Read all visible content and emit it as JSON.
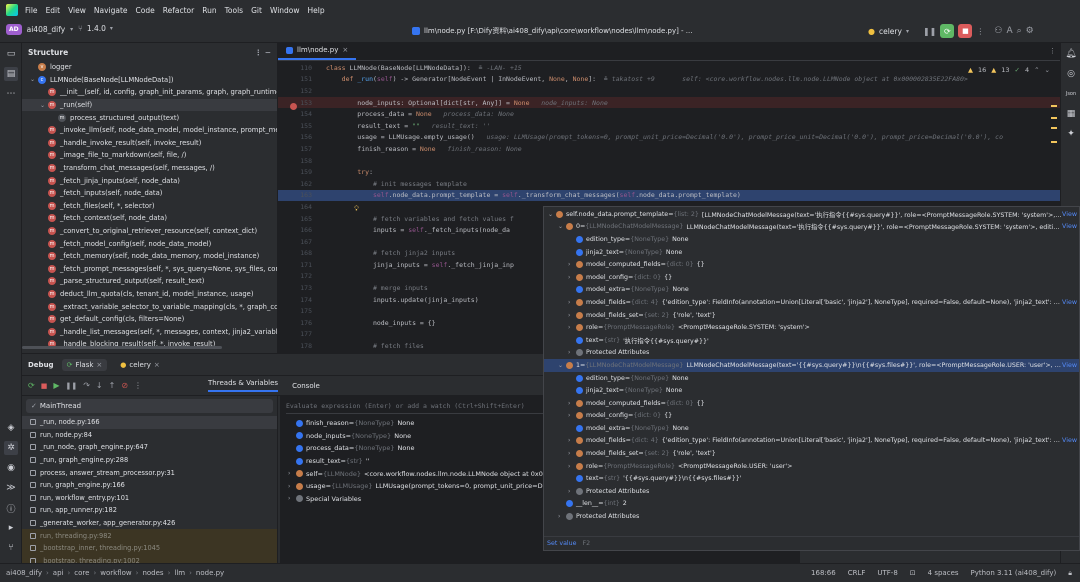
{
  "menu": [
    "File",
    "Edit",
    "View",
    "Navigate",
    "Code",
    "Refactor",
    "Run",
    "Tools",
    "Git",
    "Window",
    "Help"
  ],
  "project": {
    "badge": "AD",
    "name": "ai408_dify",
    "branch": "1.4.0"
  },
  "window_title": "llm\\node.py [F:\\Dify资料\\ai408_dify\\api\\core\\workflow\\nodes\\llm\\node.py] - ...",
  "run_config": "celery",
  "structure": {
    "title": "Structure",
    "items": [
      {
        "label": "logger",
        "indent": 0,
        "kind": "var",
        "arrow": ""
      },
      {
        "label": "LLMNode(BaseNode[LLMNodeData])",
        "indent": 0,
        "kind": "class",
        "arrow": "v"
      },
      {
        "label": "__init__(self, id, config, graph_init_params, graph, graph_runtime_state, pr",
        "indent": 1,
        "kind": "m",
        "arrow": ""
      },
      {
        "label": "_run(self)",
        "indent": 1,
        "kind": "m",
        "arrow": "v"
      },
      {
        "label": "process_structured_output(text)",
        "indent": 2,
        "kind": "f",
        "arrow": ""
      },
      {
        "label": "_invoke_llm(self, node_data_model, model_instance, prompt_messages, s",
        "indent": 1,
        "kind": "m",
        "arrow": ""
      },
      {
        "label": "_handle_invoke_result(self, invoke_result)",
        "indent": 1,
        "kind": "m",
        "arrow": ""
      },
      {
        "label": "_image_file_to_markdown(self, file, /)",
        "indent": 1,
        "kind": "m",
        "arrow": ""
      },
      {
        "label": "_transform_chat_messages(self, messages, /)",
        "indent": 1,
        "kind": "m",
        "arrow": ""
      },
      {
        "label": "_fetch_jinja_inputs(self, node_data)",
        "indent": 1,
        "kind": "m",
        "arrow": ""
      },
      {
        "label": "_fetch_inputs(self, node_data)",
        "indent": 1,
        "kind": "m",
        "arrow": ""
      },
      {
        "label": "_fetch_files(self, *, selector)",
        "indent": 1,
        "kind": "m",
        "arrow": ""
      },
      {
        "label": "_fetch_context(self, node_data)",
        "indent": 1,
        "kind": "m",
        "arrow": ""
      },
      {
        "label": "_convert_to_original_retriever_resource(self, context_dict)",
        "indent": 1,
        "kind": "m",
        "arrow": ""
      },
      {
        "label": "_fetch_model_config(self, node_data_model)",
        "indent": 1,
        "kind": "m",
        "arrow": ""
      },
      {
        "label": "_fetch_memory(self, node_data_memory, model_instance)",
        "indent": 1,
        "kind": "m",
        "arrow": ""
      },
      {
        "label": "_fetch_prompt_messages(self, *, sys_query=None, sys_files, context=None",
        "indent": 1,
        "kind": "m",
        "arrow": ""
      },
      {
        "label": "_parse_structured_output(self, result_text)",
        "indent": 1,
        "kind": "m",
        "arrow": ""
      },
      {
        "label": "deduct_llm_quota(cls, tenant_id, model_instance, usage)",
        "indent": 1,
        "kind": "m",
        "arrow": ""
      },
      {
        "label": "_extract_variable_selector_to_variable_mapping(cls, *, graph_config, node",
        "indent": 1,
        "kind": "m",
        "arrow": ""
      },
      {
        "label": "get_default_config(cls, filters=None)",
        "indent": 1,
        "kind": "m",
        "arrow": ""
      },
      {
        "label": "_handle_list_messages(self, *, messages, context, jinja2_variables, variable",
        "indent": 1,
        "kind": "m",
        "arrow": ""
      },
      {
        "label": "_handle_blocking_result(self, *, invoke_result)",
        "indent": 1,
        "kind": "m",
        "arrow": ""
      }
    ]
  },
  "editor": {
    "tab": "llm\\node.py",
    "inspections": {
      "warnings": "16",
      "weak": "13",
      "typos": "4"
    },
    "lines": [
      {
        "n": "110",
        "html": "<span class=\"kw\">class</span> LLMNode(BaseNode[LLMNodeData]):  <span class=\"hint\">≗ -LAN- +15</span>",
        "cls": ""
      },
      {
        "n": "151",
        "html": "    <span class=\"kw\">def</span> <span class=\"fn\">_run</span>(<span class=\"self\">self</span>) -&gt; Generator[NodeEvent | InNodeEvent, <span class=\"kw\">None</span>, <span class=\"kw\">None</span>]:  <span class=\"hint\">≗ takatost +9       self: &lt;core.workflow.nodes.llm.node.LLMNode object at 0x000002835E22FA80&gt;</span>",
        "cls": ""
      },
      {
        "n": "152",
        "html": "",
        "cls": ""
      },
      {
        "n": "153",
        "html": "        node_inputs: Optional[dict[str, Any]] = <span class=\"kw\">None</span>   <span class=\"hint\">node_inputs: None</span>",
        "cls": "bp"
      },
      {
        "n": "154",
        "html": "        process_data = <span class=\"kw\">None</span>   <span class=\"hint\">process_data: None</span>",
        "cls": ""
      },
      {
        "n": "155",
        "html": "        result_text = <span class=\"str\">\"\"</span>   <span class=\"hint\">result_text: ''</span>",
        "cls": ""
      },
      {
        "n": "156",
        "html": "        usage = LLMUsage.empty_usage()   <span class=\"hint\">usage: LLMUsage(prompt_tokens=0, prompt_unit_price=Decimal('0.0'), prompt_price_unit=Decimal('0.0'), prompt_price=Decimal('0.0'), co</span>",
        "cls": ""
      },
      {
        "n": "157",
        "html": "        finish_reason = <span class=\"kw\">None</span>   <span class=\"hint\">finish_reason: None</span>",
        "cls": ""
      },
      {
        "n": "158",
        "html": "",
        "cls": ""
      },
      {
        "n": "159",
        "html": "        <span class=\"kw\">try</span>:",
        "cls": ""
      },
      {
        "n": "162",
        "html": "            <span class=\"cm\"># init messages template</span>",
        "cls": ""
      },
      {
        "n": "163",
        "html": "            <span class=\"self\">self</span>.node_data.prompt_template = <span class=\"self\">self</span>._transform_chat_messages(<span class=\"self\">self</span>.node_data.prompt_template)",
        "cls": "exec"
      },
      {
        "n": "164",
        "html": "",
        "cls": ""
      },
      {
        "n": "165",
        "html": "            <span class=\"cm\"># fetch variables and fetch values f</span>",
        "cls": ""
      },
      {
        "n": "166",
        "html": "            inputs = <span class=\"self\">self</span>._fetch_inputs(node_da",
        "cls": ""
      },
      {
        "n": "167",
        "html": "",
        "cls": ""
      },
      {
        "n": "168",
        "html": "            <span class=\"cm\"># fetch jinja2 inputs</span>",
        "cls": ""
      },
      {
        "n": "171",
        "html": "            jinja_inputs = <span class=\"self\">self</span>._fetch_jinja_inp",
        "cls": ""
      },
      {
        "n": "172",
        "html": "",
        "cls": ""
      },
      {
        "n": "173",
        "html": "            <span class=\"cm\"># merge inputs</span>",
        "cls": ""
      },
      {
        "n": "174",
        "html": "            inputs.update(jinja_inputs)",
        "cls": ""
      },
      {
        "n": "175",
        "html": "",
        "cls": ""
      },
      {
        "n": "176",
        "html": "            node_inputs = {}",
        "cls": ""
      },
      {
        "n": "177",
        "html": "",
        "cls": ""
      },
      {
        "n": "178",
        "html": "            <span class=\"cm\"># fetch files</span>",
        "cls": ""
      }
    ]
  },
  "debug": {
    "label": "Debug",
    "configs": [
      "Flask",
      "celery"
    ],
    "tabs": [
      "Threads & Variables",
      "Console"
    ],
    "thread": "MainThread",
    "eval_placeholder": "Evaluate expression (Enter) or add a watch (Ctrl+Shift+Enter)",
    "frames": [
      {
        "label": "_run, node.py:166",
        "dim": false,
        "sel": true
      },
      {
        "label": "run, node.py:84",
        "dim": false,
        "sel": false
      },
      {
        "label": "_run_node, graph_engine.py:647",
        "dim": false,
        "sel": false
      },
      {
        "label": "_run, graph_engine.py:288",
        "dim": false,
        "sel": false
      },
      {
        "label": "process, answer_stream_processor.py:31",
        "dim": false,
        "sel": false
      },
      {
        "label": "run, graph_engine.py:166",
        "dim": false,
        "sel": false
      },
      {
        "label": "run, workflow_entry.py:101",
        "dim": false,
        "sel": false
      },
      {
        "label": "run, app_runner.py:182",
        "dim": false,
        "sel": false
      },
      {
        "label": "_generate_worker, app_generator.py:426",
        "dim": false,
        "sel": false
      },
      {
        "label": "run, threading.py:982",
        "dim": true,
        "sel": false
      },
      {
        "label": "_bootstrap_inner, threading.py:1045",
        "dim": true,
        "sel": false
      },
      {
        "label": "_bootstrap, threading.py:1002",
        "dim": true,
        "sel": false
      }
    ],
    "variables": [
      {
        "arrow": "",
        "name": "finish_reason",
        "type": "{NoneType}",
        "value": "None",
        "icon": "b"
      },
      {
        "arrow": "",
        "name": "node_inputs",
        "type": "{NoneType}",
        "value": "None",
        "icon": "b"
      },
      {
        "arrow": "",
        "name": "process_data",
        "type": "{NoneType}",
        "value": "None",
        "icon": "b"
      },
      {
        "arrow": "",
        "name": "result_text",
        "type": "{str}",
        "value": "''",
        "icon": "b"
      },
      {
        "arrow": ">",
        "name": "self",
        "type": "{LLMNode}",
        "value": "<core.workflow.nodes.llm.node.LLMNode object at 0x00",
        "icon": "o"
      },
      {
        "arrow": ">",
        "name": "usage",
        "type": "{LLMUsage}",
        "value": "LLMUsage(prompt_tokens=0, prompt_unit_price=Dec",
        "icon": "o"
      },
      {
        "arrow": ">",
        "name": "Special Variables",
        "type": "",
        "value": "",
        "icon": "s"
      }
    ]
  },
  "popup": {
    "rows": [
      {
        "ind": 0,
        "arrow": "v",
        "name": "self.node_data.prompt_template",
        "type": "{list: 2}",
        "value": "[LLMNodeChatModelMessage(text='执行指令{{#sys.query#}}', role=<PromptMessageRole.SYSTEM: 'system'>, edit...",
        "view": "View",
        "sel": false
      },
      {
        "ind": 1,
        "arrow": "v",
        "name": "0",
        "type": "{LLMNodeChatModelMessage}",
        "value": "LLMNodeChatModelMessage(text='执行指令{{#sys.query#}}', role=<PromptMessageRole.SYSTEM: 'system'>, edition_...",
        "view": "View",
        "sel": false
      },
      {
        "ind": 2,
        "arrow": "",
        "name": "edition_type",
        "type": "{NoneType}",
        "value": "None",
        "view": "",
        "sel": false
      },
      {
        "ind": 2,
        "arrow": "",
        "name": "jinja2_text",
        "type": "{NoneType}",
        "value": "None",
        "view": "",
        "sel": false
      },
      {
        "ind": 2,
        "arrow": ">",
        "name": "model_computed_fields",
        "type": "{dict: 0}",
        "value": "{}",
        "view": "",
        "sel": false
      },
      {
        "ind": 2,
        "arrow": ">",
        "name": "model_config",
        "type": "{dict: 0}",
        "value": "{}",
        "view": "",
        "sel": false
      },
      {
        "ind": 2,
        "arrow": "",
        "name": "model_extra",
        "type": "{NoneType}",
        "value": "None",
        "view": "",
        "sel": false
      },
      {
        "ind": 2,
        "arrow": ">",
        "name": "model_fields",
        "type": "{dict: 4}",
        "value": "{'edition_type': FieldInfo(annotation=Union[Literal['basic', 'jinja2'], NoneType], required=False, default=None), 'jinja2_text': FieldIn...",
        "view": "View",
        "sel": false
      },
      {
        "ind": 2,
        "arrow": ">",
        "name": "model_fields_set",
        "type": "{set: 2}",
        "value": "{'role', 'text'}",
        "view": "",
        "sel": false
      },
      {
        "ind": 2,
        "arrow": ">",
        "name": "role",
        "type": "{PromptMessageRole}",
        "value": "<PromptMessageRole.SYSTEM: 'system'>",
        "view": "",
        "sel": false
      },
      {
        "ind": 2,
        "arrow": "",
        "name": "text",
        "type": "{str}",
        "value": "'执行指令{{#sys.query#}}'",
        "view": "",
        "sel": false
      },
      {
        "ind": 2,
        "arrow": ">",
        "name": "Protected Attributes",
        "type": "",
        "value": "",
        "view": "",
        "sel": false
      },
      {
        "ind": 1,
        "arrow": "v",
        "name": "1",
        "type": "{LLMNodeChatModelMessage}",
        "value": "LLMNodeChatModelMessage(text='{{#sys.query#}}\\n{{#sys.files#}}', role=<PromptMessageRole.USER: 'user'>, edition_t...",
        "view": "View",
        "sel": true
      },
      {
        "ind": 2,
        "arrow": "",
        "name": "edition_type",
        "type": "{NoneType}",
        "value": "None",
        "view": "",
        "sel": false
      },
      {
        "ind": 2,
        "arrow": "",
        "name": "jinja2_text",
        "type": "{NoneType}",
        "value": "None",
        "view": "",
        "sel": false
      },
      {
        "ind": 2,
        "arrow": ">",
        "name": "model_computed_fields",
        "type": "{dict: 0}",
        "value": "{}",
        "view": "",
        "sel": false
      },
      {
        "ind": 2,
        "arrow": ">",
        "name": "model_config",
        "type": "{dict: 0}",
        "value": "{}",
        "view": "",
        "sel": false
      },
      {
        "ind": 2,
        "arrow": "",
        "name": "model_extra",
        "type": "{NoneType}",
        "value": "None",
        "view": "",
        "sel": false
      },
      {
        "ind": 2,
        "arrow": ">",
        "name": "model_fields",
        "type": "{dict: 4}",
        "value": "{'edition_type': FieldInfo(annotation=Union[Literal['basic', 'jinja2'], NoneType], required=False, default=None), 'jinja2_text': FieldIn...",
        "view": "View",
        "sel": false
      },
      {
        "ind": 2,
        "arrow": ">",
        "name": "model_fields_set",
        "type": "{set: 2}",
        "value": "{'role', 'text'}",
        "view": "",
        "sel": false
      },
      {
        "ind": 2,
        "arrow": ">",
        "name": "role",
        "type": "{PromptMessageRole}",
        "value": "<PromptMessageRole.USER: 'user'>",
        "view": "",
        "sel": false
      },
      {
        "ind": 2,
        "arrow": "",
        "name": "text",
        "type": "{str}",
        "value": "'{{#sys.query#}}\\n{{#sys.files#}}'",
        "view": "",
        "sel": false
      },
      {
        "ind": 2,
        "arrow": ">",
        "name": "Protected Attributes",
        "type": "",
        "value": "",
        "view": "",
        "sel": false
      },
      {
        "ind": 1,
        "arrow": "",
        "name": "__len__",
        "type": "{int}",
        "value": "2",
        "view": "",
        "sel": false
      },
      {
        "ind": 1,
        "arrow": ">",
        "name": "Protected Attributes",
        "type": "",
        "value": "",
        "view": "",
        "sel": false
      }
    ],
    "footer_label": "Set value",
    "footer_key": "F2"
  },
  "status": {
    "breadcrumbs": [
      "ai408_dify",
      "api",
      "core",
      "workflow",
      "nodes",
      "llm",
      "node.py"
    ],
    "position": "168:66",
    "line_sep": "CRLF",
    "encoding": "UTF-8",
    "indent": "4 spaces",
    "interpreter": "Python 3.11 (ai408_dify)"
  },
  "colors": {
    "accent": "#3574f0",
    "breakpoint": "#c75450",
    "run_green": "#5fb865",
    "stop_red": "#db5c5c"
  }
}
